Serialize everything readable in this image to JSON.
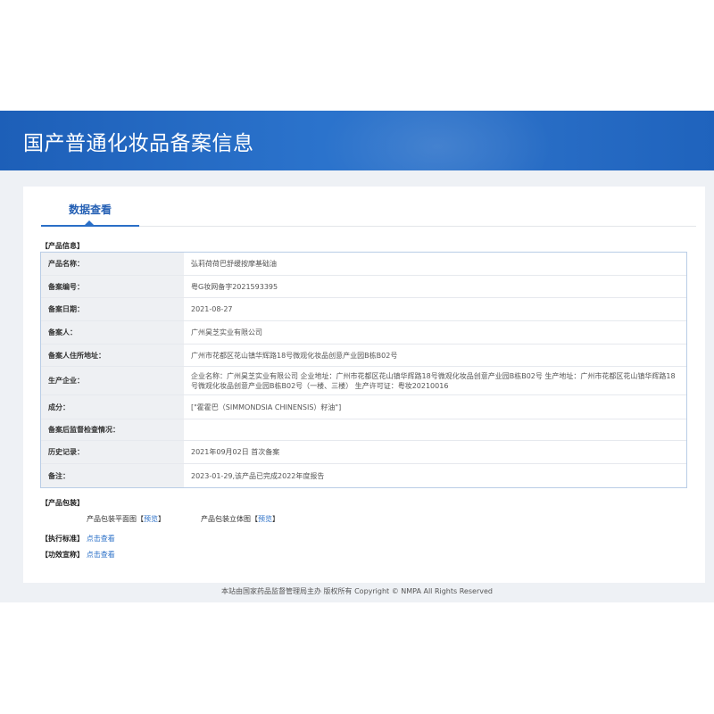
{
  "header": {
    "title": "国产普通化妆品备案信息"
  },
  "tab": {
    "label": "数据查看"
  },
  "product_info": {
    "section_label": "【产品信息】",
    "rows": [
      {
        "label": "产品名称：",
        "value": "弘莉荷荷巴舒缓按摩基础油"
      },
      {
        "label": "备案编号：",
        "value": "粤G妆网备字2021593395"
      },
      {
        "label": "备案日期：",
        "value": "2021-08-27"
      },
      {
        "label": "备案人：",
        "value": "广州昊芝实业有限公司"
      },
      {
        "label": "备案人住所地址：",
        "value": "广州市花都区花山镇华辉路18号微观化妆品创意产业园B栋B02号"
      },
      {
        "label": "生产企业：",
        "value": "企业名称：广州昊芝实业有限公司 企业地址：广州市花都区花山镇华辉路18号微观化妆品创意产业园B栋B02号 生产地址：广州市花都区花山镇华辉路18号微观化妆品创意产业园B栋B02号（一楼、三楼） 生产许可证：粤妆20210016"
      },
      {
        "label": "成分：",
        "value": "[\"霍霍巴（SIMMONDSIA CHINENSIS）籽油\"]"
      },
      {
        "label": "备案后监督检查情况：",
        "value": ""
      },
      {
        "label": "历史记录：",
        "value": "2021年09月02日 首次备案"
      },
      {
        "label": "备注：",
        "value": "2023-01-29,该产品已完成2022年度报告"
      }
    ]
  },
  "packaging": {
    "section_label": "【产品包装】",
    "flat_label": "产品包装平面图",
    "flat_link": "预览",
    "solid_label": "产品包装立体图",
    "solid_link": "预览",
    "bracket_open": "【",
    "bracket_close": "】"
  },
  "standard": {
    "section_label": "【执行标准】",
    "link": "点击查看"
  },
  "efficacy": {
    "section_label": "【功效宣称】",
    "link": "点击查看"
  },
  "footer": {
    "text": "本站由国家药品监督管理局主办 版权所有 Copyright © NMPA All Rights Reserved"
  }
}
